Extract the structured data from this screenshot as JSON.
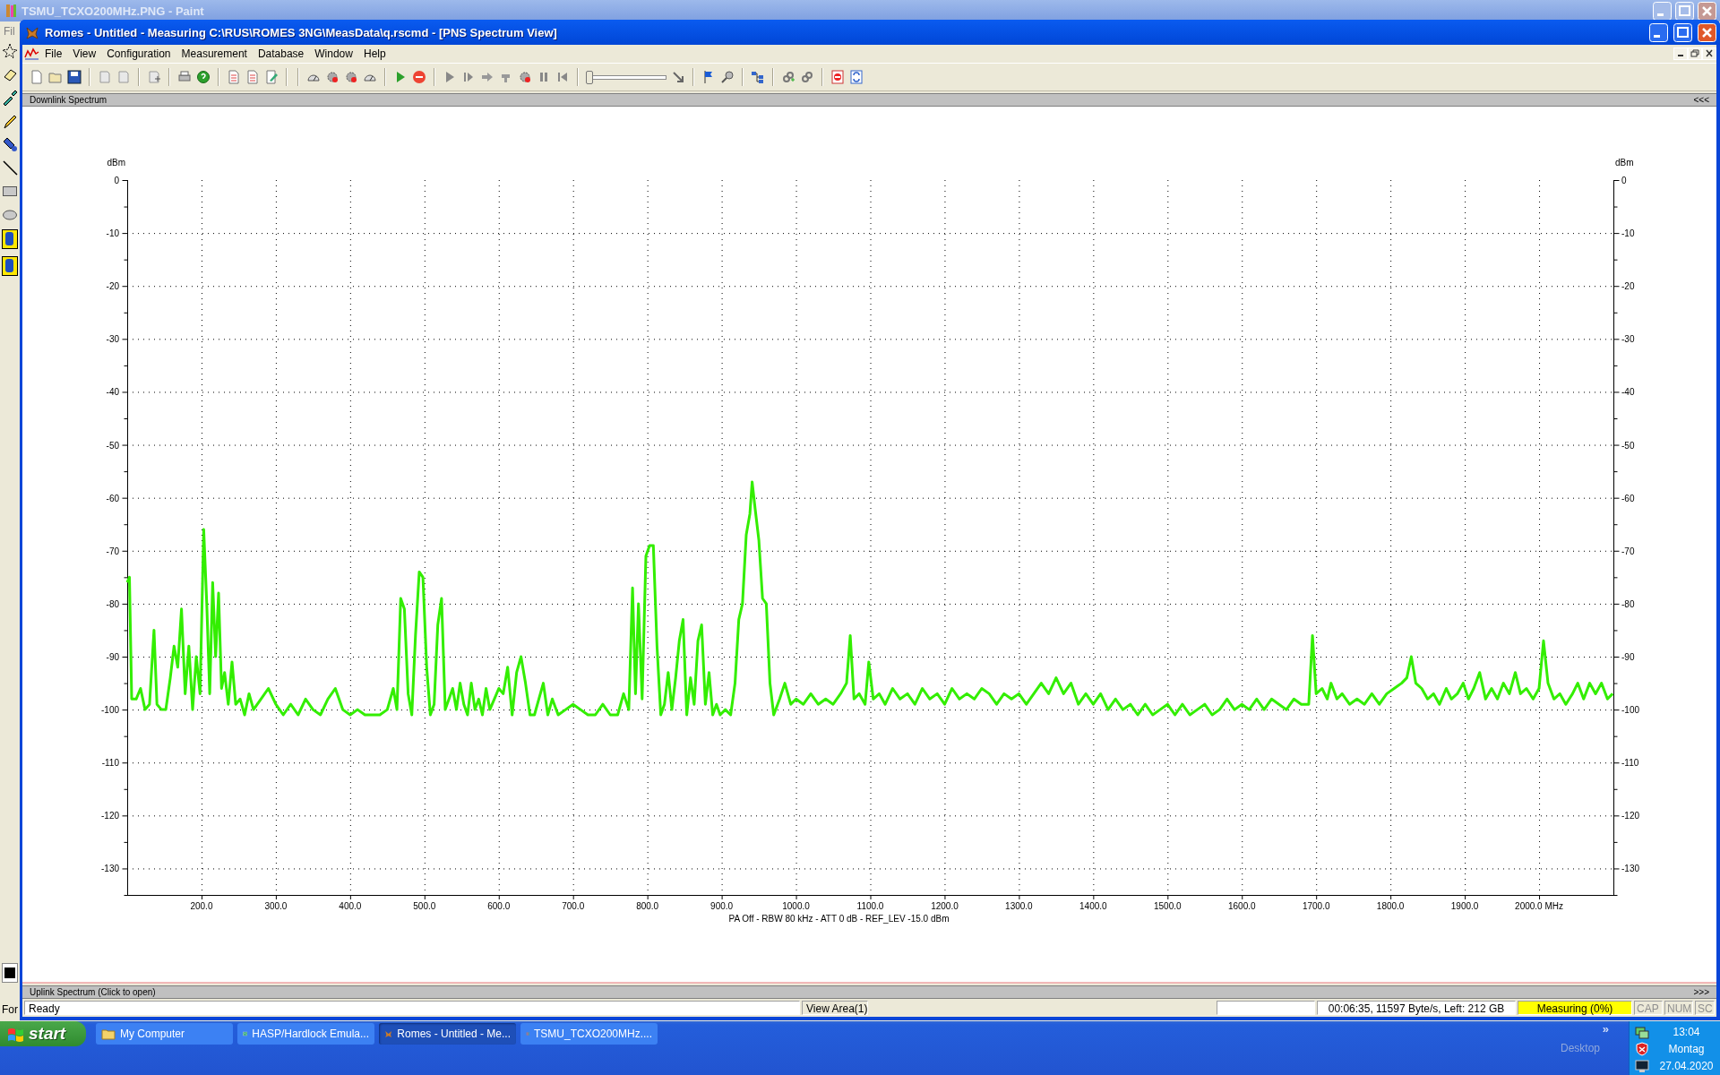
{
  "paint_window": {
    "title": "TSMU_TCXO200MHz.PNG - Paint",
    "menu_item": "Fil",
    "status_text": "For"
  },
  "window": {
    "title": "Romes - Untitled - Measuring C:\\RUS\\ROMES 3NG\\MeasData\\q.rscmd - [PNS Spectrum View]"
  },
  "menu": [
    "File",
    "View",
    "Configuration",
    "Measurement",
    "Database",
    "Window",
    "Help"
  ],
  "toolbar": {
    "slider": {
      "level": 0
    }
  },
  "downlink_panel": {
    "title": "Downlink Spectrum",
    "toggle": "<<<",
    "expanded": true,
    "chart_data": {
      "type": "line",
      "xlabel": "PA Off - RBW 80 kHz - ATT 0 dB - REF_LEV -15.0 dBm",
      "ylabel": "dBm",
      "xlim": [
        100,
        2100
      ],
      "ylim": [
        -135,
        0
      ],
      "xticks": [
        {
          "value": 200,
          "label": "200.0"
        },
        {
          "value": 300,
          "label": "300.0"
        },
        {
          "value": 400,
          "label": "400.0"
        },
        {
          "value": 500,
          "label": "500.0"
        },
        {
          "value": 600,
          "label": "600.0"
        },
        {
          "value": 700,
          "label": "700.0"
        },
        {
          "value": 800,
          "label": "800.0"
        },
        {
          "value": 900,
          "label": "900.0"
        },
        {
          "value": 1000,
          "label": "1000.0"
        },
        {
          "value": 1100,
          "label": "1100.0"
        },
        {
          "value": 1200,
          "label": "1200.0"
        },
        {
          "value": 1300,
          "label": "1300.0"
        },
        {
          "value": 1400,
          "label": "1400.0"
        },
        {
          "value": 1500,
          "label": "1500.0"
        },
        {
          "value": 1600,
          "label": "1600.0"
        },
        {
          "value": 1700,
          "label": "1700.0"
        },
        {
          "value": 1800,
          "label": "1800.0"
        },
        {
          "value": 1900,
          "label": "1900.0"
        },
        {
          "value": 2000,
          "label": "2000.0 MHz"
        }
      ],
      "grid": true,
      "yticks": [
        {
          "value": 0,
          "label": "0"
        },
        {
          "value": -10,
          "label": "-10"
        },
        {
          "value": -20,
          "label": "-20"
        },
        {
          "value": -30,
          "label": "-30"
        },
        {
          "value": -40,
          "label": "-40"
        },
        {
          "value": -50,
          "label": "-50"
        },
        {
          "value": -60,
          "label": "-60"
        },
        {
          "value": -70,
          "label": "-70"
        },
        {
          "value": -80,
          "label": "-80"
        },
        {
          "value": -90,
          "label": "-90"
        },
        {
          "value": -100,
          "label": "-100"
        },
        {
          "value": -110,
          "label": "-110"
        },
        {
          "value": -120,
          "label": "-120"
        },
        {
          "value": -130,
          "label": "-130"
        }
      ],
      "x": [
        100,
        103,
        106,
        112,
        118,
        124,
        130,
        136,
        140,
        146,
        152,
        158,
        163,
        168,
        173,
        178,
        183,
        188,
        193,
        198,
        203,
        207,
        211,
        215,
        219,
        223,
        227,
        231,
        236,
        241,
        246,
        252,
        258,
        264,
        270,
        280,
        290,
        300,
        310,
        320,
        330,
        340,
        350,
        360,
        370,
        380,
        390,
        400,
        410,
        420,
        430,
        440,
        450,
        458,
        463,
        468,
        473,
        478,
        483,
        488,
        493,
        498,
        503,
        508,
        513,
        518,
        523,
        528,
        533,
        538,
        543,
        548,
        553,
        558,
        563,
        568,
        573,
        578,
        583,
        588,
        594,
        600,
        606,
        612,
        618,
        624,
        630,
        636,
        642,
        648,
        654,
        660,
        666,
        672,
        680,
        690,
        700,
        710,
        720,
        730,
        740,
        750,
        760,
        768,
        775,
        780,
        784,
        788,
        793,
        798,
        803,
        808,
        813,
        818,
        823,
        828,
        833,
        838,
        843,
        848,
        853,
        858,
        863,
        868,
        873,
        878,
        883,
        888,
        893,
        898,
        905,
        912,
        918,
        923,
        928,
        933,
        938,
        941,
        945,
        950,
        955,
        960,
        965,
        970,
        978,
        985,
        993,
        1000,
        1010,
        1020,
        1030,
        1040,
        1050,
        1060,
        1068,
        1073,
        1078,
        1085,
        1093,
        1098,
        1104,
        1112,
        1120,
        1130,
        1140,
        1150,
        1160,
        1170,
        1180,
        1190,
        1200,
        1210,
        1220,
        1230,
        1240,
        1250,
        1260,
        1270,
        1280,
        1290,
        1300,
        1310,
        1320,
        1330,
        1340,
        1350,
        1360,
        1370,
        1380,
        1390,
        1400,
        1410,
        1420,
        1430,
        1440,
        1450,
        1460,
        1470,
        1480,
        1490,
        1500,
        1510,
        1520,
        1530,
        1540,
        1550,
        1560,
        1570,
        1580,
        1590,
        1600,
        1610,
        1620,
        1630,
        1640,
        1650,
        1660,
        1670,
        1680,
        1690,
        1695,
        1700,
        1708,
        1715,
        1720,
        1728,
        1735,
        1745,
        1755,
        1765,
        1775,
        1785,
        1795,
        1805,
        1815,
        1822,
        1828,
        1834,
        1842,
        1850,
        1858,
        1866,
        1875,
        1882,
        1890,
        1898,
        1905,
        1912,
        1920,
        1928,
        1936,
        1944,
        1952,
        1960,
        1968,
        1975,
        1983,
        1992,
        2000,
        2006,
        2012,
        2020,
        2028,
        2036,
        2045,
        2052,
        2060,
        2068,
        2076,
        2084,
        2092,
        2099
      ],
      "series": [
        {
          "color": "#33ee00",
          "values": [
            -76,
            -75,
            -98,
            -98,
            -96,
            -100,
            -99,
            -85,
            -99,
            -100,
            -100,
            -94,
            -88,
            -92,
            -81,
            -97,
            -88,
            -100,
            -90,
            -97,
            -66,
            -80,
            -97,
            -76,
            -90,
            -78,
            -96,
            -93,
            -99,
            -91,
            -99,
            -98,
            -101,
            -97,
            -100,
            -98,
            -96,
            -99,
            -101,
            -99,
            -101,
            -98,
            -100,
            -101,
            -98,
            -96,
            -100,
            -101,
            -100,
            -101,
            -101,
            -101,
            -100,
            -96,
            -100,
            -79,
            -81,
            -97,
            -101,
            -86,
            -74,
            -75,
            -92,
            -101,
            -99,
            -84,
            -79,
            -100,
            -98,
            -96,
            -100,
            -95,
            -99,
            -101,
            -95,
            -100,
            -98,
            -101,
            -96,
            -100,
            -98,
            -96,
            -97,
            -92,
            -101,
            -93,
            -90,
            -95,
            -101,
            -101,
            -98,
            -95,
            -101,
            -98,
            -101,
            -100,
            -99,
            -100,
            -101,
            -101,
            -99,
            -101,
            -101,
            -97,
            -100,
            -77,
            -97,
            -80,
            -98,
            -71,
            -69,
            -69,
            -88,
            -101,
            -99,
            -93,
            -100,
            -94,
            -87,
            -83,
            -101,
            -94,
            -99,
            -87,
            -84,
            -99,
            -93,
            -101,
            -99,
            -101,
            -100,
            -101,
            -95,
            -83,
            -80,
            -67,
            -63,
            -57,
            -62,
            -68,
            -79,
            -80,
            -95,
            -101,
            -98,
            -95,
            -99,
            -98,
            -99,
            -97,
            -99,
            -98,
            -99,
            -97,
            -95,
            -86,
            -98,
            -97,
            -99,
            -91,
            -98,
            -97,
            -99,
            -96,
            -98,
            -97,
            -99,
            -96,
            -98,
            -97,
            -99,
            -96,
            -98,
            -97,
            -98,
            -96,
            -97,
            -99,
            -97,
            -98,
            -97,
            -99,
            -97,
            -95,
            -97,
            -94,
            -97,
            -95,
            -99,
            -97,
            -99,
            -97,
            -100,
            -98,
            -100,
            -99,
            -101,
            -99,
            -101,
            -100,
            -99,
            -101,
            -99,
            -101,
            -100,
            -99,
            -101,
            -100,
            -98,
            -100,
            -99,
            -100,
            -98,
            -100,
            -98,
            -99,
            -100,
            -98,
            -99,
            -99,
            -86,
            -97,
            -96,
            -98,
            -95,
            -98,
            -97,
            -99,
            -98,
            -99,
            -97,
            -99,
            -97,
            -96,
            -95,
            -94,
            -90,
            -95,
            -96,
            -98,
            -97,
            -99,
            -96,
            -98,
            -97,
            -95,
            -98,
            -96,
            -93,
            -98,
            -96,
            -98,
            -95,
            -97,
            -93,
            -97,
            -96,
            -98,
            -96,
            -87,
            -95,
            -98,
            -97,
            -99,
            -97,
            -95,
            -98,
            -95,
            -97,
            -95,
            -98,
            -97
          ]
        }
      ]
    }
  },
  "right_axis": {
    "label": "dBm",
    "ticks": [
      "0",
      "-10",
      "-20",
      "-30",
      "-40",
      "-50",
      "-60",
      "-70",
      "-80",
      "-90",
      "-100",
      "-110",
      "-120",
      "-130"
    ]
  },
  "uplink_panel": {
    "title": "Uplink Spectrum (Click to open)",
    "toggle": ">>>",
    "expanded": false
  },
  "status_bar": [
    {
      "kind": "text",
      "text": "Ready"
    },
    {
      "kind": "text",
      "text": "View Area(1)"
    },
    {
      "kind": "spacer"
    },
    {
      "kind": "blank"
    },
    {
      "kind": "text",
      "text": "00:06:35, 11597 Byte/s, Left: 212 GB"
    },
    {
      "kind": "text",
      "text": "Measuring (0%)",
      "highlighted": true
    },
    {
      "kind": "indicator",
      "text": "CAP",
      "disabled": true
    },
    {
      "kind": "indicator",
      "text": "NUM",
      "disabled": true
    },
    {
      "kind": "indicator",
      "text": "SC",
      "disabled": true
    }
  ],
  "taskbar": {
    "start": "start",
    "tasks": [
      {
        "label": "My Computer",
        "selected": false
      },
      {
        "label": "HASP/Hardlock Emula...",
        "selected": false
      },
      {
        "label": "Romes - Untitled - Me...",
        "selected": true
      },
      {
        "label": "TSMU_TCXO200MHz....",
        "selected": false
      }
    ],
    "chevron": "»",
    "toolbar_label": "Desktop",
    "clock": {
      "time": "13:04",
      "day": "Montag",
      "date": "27.04.2020"
    }
  }
}
